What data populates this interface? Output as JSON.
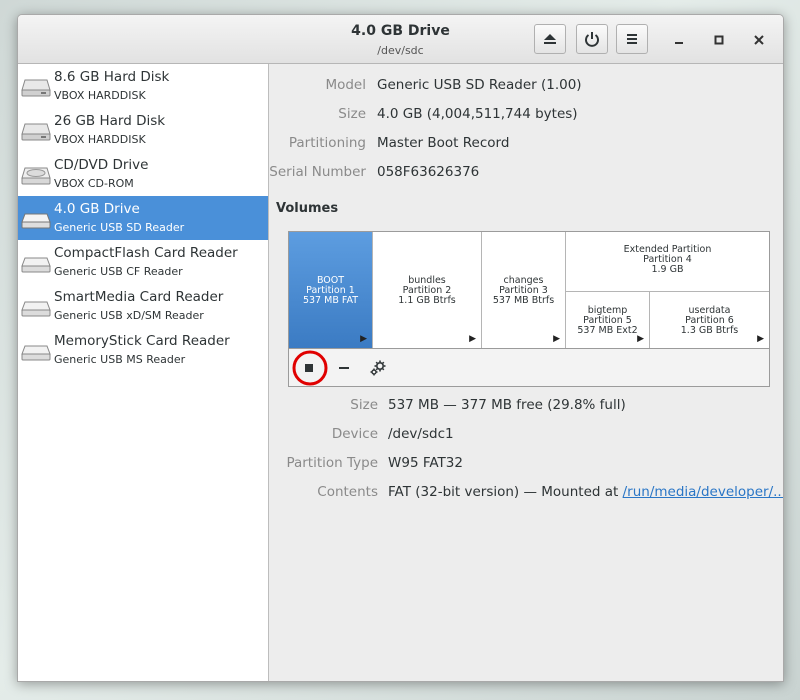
{
  "window": {
    "title": "4.0 GB Drive",
    "subtitle": "/dev/sdc",
    "buttons": [
      "eject-icon",
      "power-icon",
      "menu-icon"
    ],
    "controls": {
      "minimize": "–",
      "maximize": "□",
      "close": "×"
    }
  },
  "sidebar": {
    "items": [
      {
        "name": "8.6 GB Hard Disk",
        "sub": "VBOX HARDDISK",
        "icon": "hard-disk-icon"
      },
      {
        "name": "26 GB Hard Disk",
        "sub": "VBOX HARDDISK",
        "icon": "hard-disk-icon"
      },
      {
        "name": "CD/DVD Drive",
        "sub": "VBOX CD-ROM",
        "icon": "optical-drive-icon"
      },
      {
        "name": "4.0 GB Drive",
        "sub": "Generic USB SD Reader",
        "icon": "removable-drive-icon",
        "selected": true
      },
      {
        "name": "CompactFlash Card Reader",
        "sub": "Generic USB CF Reader",
        "icon": "card-reader-icon"
      },
      {
        "name": "SmartMedia Card Reader",
        "sub": "Generic USB xD/SM Reader",
        "icon": "card-reader-icon"
      },
      {
        "name": "MemoryStick Card Reader",
        "sub": "Generic USB MS Reader",
        "icon": "card-reader-icon"
      }
    ]
  },
  "drive_info": {
    "model_label": "Model",
    "model": "Generic USB SD Reader (1.00)",
    "size_label": "Size",
    "size": "4.0 GB (4,004,511,744 bytes)",
    "partitioning_label": "Partitioning",
    "partitioning": "Master Boot Record",
    "serial_label": "Serial Number",
    "serial": "058F63626376"
  },
  "volumes": {
    "title": "Volumes",
    "partitions": {
      "p1": {
        "line1": "BOOT",
        "line2": "Partition 1",
        "line3": "537 MB FAT"
      },
      "p2": {
        "line1": "bundles",
        "line2": "Partition 2",
        "line3": "1.1 GB Btrfs"
      },
      "p3": {
        "line1": "changes",
        "line2": "Partition 3",
        "line3": "537 MB Btrfs"
      },
      "p4": {
        "line1": "Extended Partition",
        "line2": "Partition 4",
        "line3": "1.9 GB"
      },
      "p5": {
        "line1": "bigtemp",
        "line2": "Partition 5",
        "line3": "537 MB Ext2"
      },
      "p6": {
        "line1": "userdata",
        "line2": "Partition 6",
        "line3": "1.3 GB Btrfs"
      }
    },
    "toolbar": {
      "unmount": "stop-icon",
      "remove": "minus-icon",
      "settings": "gears-icon"
    }
  },
  "volume_info": {
    "size_label": "Size",
    "size": "537 MB — 377 MB free (29.8% full)",
    "device_label": "Device",
    "device": "/dev/sdc1",
    "type_label": "Partition Type",
    "type": "W95 FAT32",
    "contents_label": "Contents",
    "contents_prefix": "FAT (32-bit version) — Mounted at ",
    "contents_link": "/run/media/developer/..."
  },
  "colors": {
    "selection": "#4a90d9",
    "link": "#2a76c6",
    "highlight_circle": "#e00000"
  }
}
